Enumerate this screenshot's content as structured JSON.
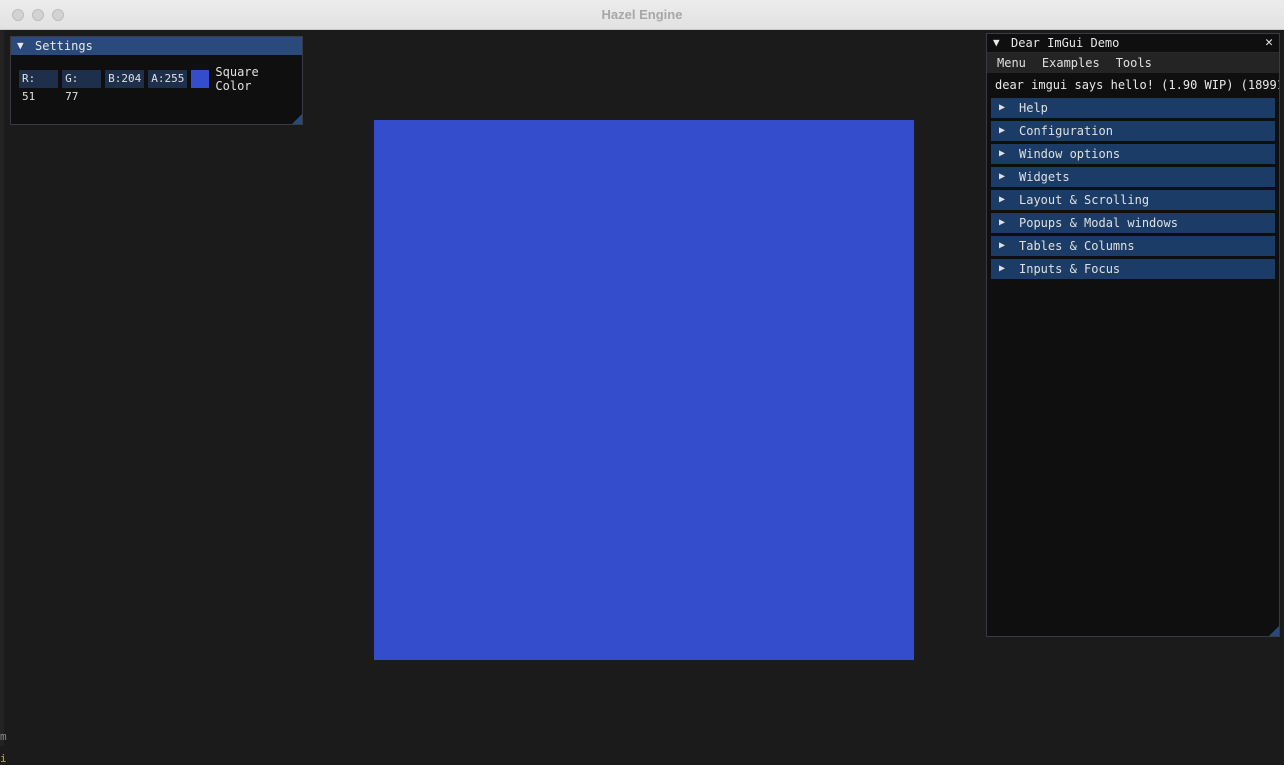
{
  "window": {
    "title": "Hazel Engine"
  },
  "edge_marks": [
    "m",
    "i"
  ],
  "settings": {
    "title": "Settings",
    "channels": {
      "r": "R: 51",
      "g": "G: 77",
      "b": "B:204",
      "a": "A:255"
    },
    "color_label": "Square Color",
    "color_hex": "#334dcc"
  },
  "demo": {
    "title": "Dear ImGui Demo",
    "menu": [
      "Menu",
      "Examples",
      "Tools"
    ],
    "hello": "dear imgui says hello! (1.90 WIP) (18991",
    "headers": [
      "Help",
      "Configuration",
      "Window options",
      "Widgets",
      "Layout & Scrolling",
      "Popups & Modal windows",
      "Tables & Columns",
      "Inputs & Focus"
    ]
  },
  "icons": {
    "collapse": "triangle-down-icon",
    "expand": "triangle-right-icon",
    "close": "close-icon"
  },
  "colors": {
    "background": "#1b1b1b",
    "square": "#334dcc",
    "header": "#294a7a",
    "collapsing_header": "#1b3c66"
  }
}
